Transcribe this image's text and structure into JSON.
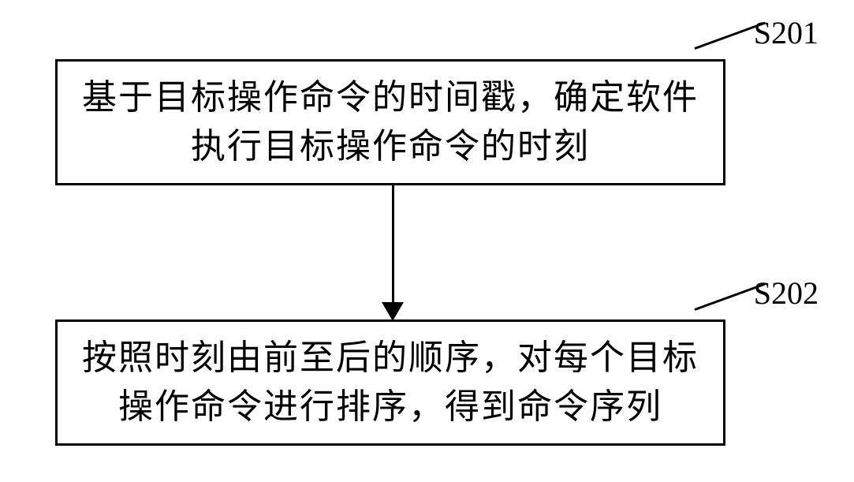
{
  "chart_data": {
    "type": "flowchart",
    "steps": [
      {
        "id": "S201",
        "text": "基于目标操作命令的时间戳，确定软件执行目标操作命令的时刻",
        "order": 1
      },
      {
        "id": "S202",
        "text": "按照时刻由前至后的顺序，对每个目标操作命令进行排序，得到命令序列",
        "order": 2
      }
    ],
    "connections": [
      {
        "from": "S201",
        "to": "S202",
        "type": "arrow"
      }
    ]
  },
  "step1": {
    "label": "S201",
    "text": "基于目标操作命令的时间戳，确定软件执行目标操作命令的时刻"
  },
  "step2": {
    "label": "S202",
    "text": "按照时刻由前至后的顺序，对每个目标操作命令进行排序，得到命令序列"
  }
}
